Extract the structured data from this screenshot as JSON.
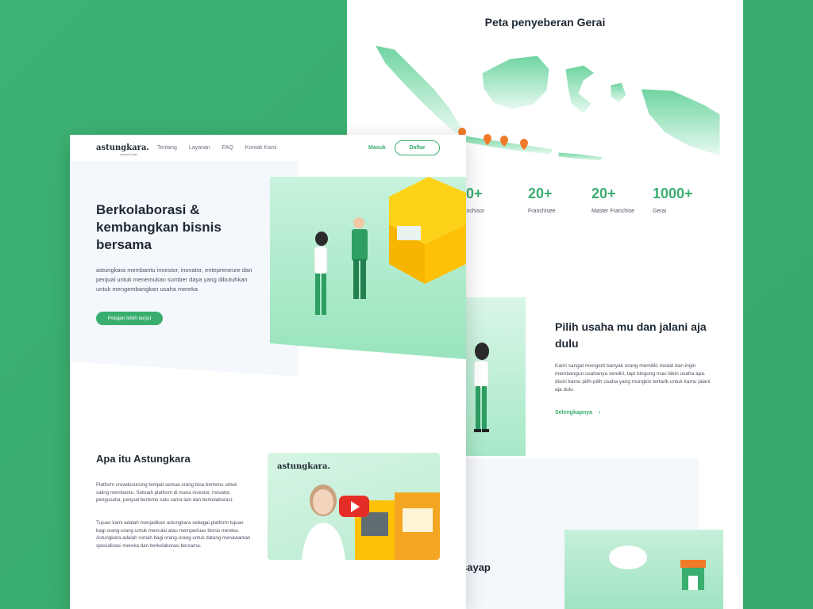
{
  "back": {
    "map_title": "Peta penyeberan Gerai",
    "stats": [
      {
        "num": "50+",
        "label": "Franchisor"
      },
      {
        "num": "20+",
        "label": "Franchisee"
      },
      {
        "num": "20+",
        "label": "Master Franchise"
      },
      {
        "num": "1000+",
        "label": "Gerai"
      }
    ],
    "pilih_title": "Pilih usaha mu dan jalani aja dulu",
    "pilih_desc": "Kami sangat mengerti banyak orang memiliki modal dan ingin membangun usahanya sendiri, tapi bingung mau bikin usaha apa. disini kamu pilih-pilih usaha yang mungkin tertarik untuk kamu jalani aja dulu",
    "pilih_link": "Selengkapnya",
    "sayap": "sayap"
  },
  "nav": {
    "logo": "astungkara.",
    "logo_sub": "tumbuh & jual",
    "links": [
      "Tentang",
      "Layanan",
      "FAQ",
      "Kontak Kami"
    ],
    "masuk": "Masuk",
    "daftar": "Daftar"
  },
  "hero": {
    "title": "Berkolaborasi & kembangkan bisnis bersama",
    "desc": "astungkara membantu investor, inovator, entepreneure dan penjual untuk menemukan sumber daya yang dibutuhkan untuk mengembangkan usaha mereka",
    "button": "Pelajari lebih lanjut"
  },
  "apa": {
    "title": "Apa itu Astungkara",
    "p1": "Platform crowdsourcing tempat semua orang bisa bertemu untuk saling membantu. Sebuah platform di mana investor, inovator, pengusaha, penjual bertemu satu sama lain dan berkolaborasi.",
    "p2": "Tujuan kami adalah menjadikan astungkara sebagai platform tujuan bagi orang-orang untuk memulai atau memperluas bisnis mereka. Astungkara adalah rumah bagi orang-orang untuk datang menawarkan spesialisasi mereka dan berkolaborasi bersama.",
    "video_logo": "astungkara."
  },
  "colors": {
    "brand": "#3aae6f",
    "background": "#3aae6f",
    "play": "#e52d27",
    "map_pin": "#f07a2a"
  }
}
